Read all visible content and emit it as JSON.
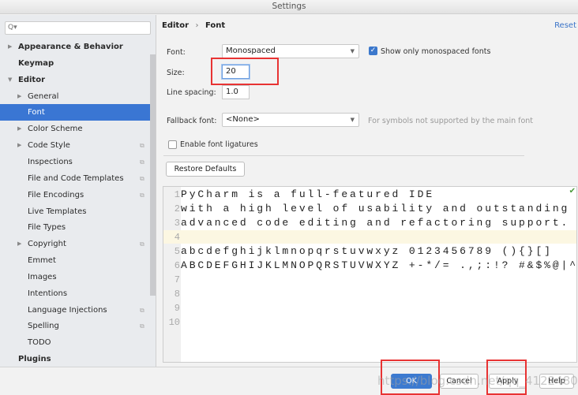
{
  "window": {
    "title": "Settings"
  },
  "search": {
    "placeholder": "Q▾"
  },
  "sidebar": {
    "items": [
      {
        "label": "Appearance & Behavior",
        "bold": true,
        "expandable": true
      },
      {
        "label": "Keymap",
        "bold": true
      },
      {
        "label": "Editor",
        "bold": true,
        "expanded": true
      },
      {
        "label": "General",
        "expandable": true
      },
      {
        "label": "Font",
        "selected": true
      },
      {
        "label": "Color Scheme",
        "expandable": true
      },
      {
        "label": "Code Style",
        "expandable": true,
        "copy_icon": true
      },
      {
        "label": "Inspections",
        "copy_icon": true
      },
      {
        "label": "File and Code Templates",
        "copy_icon": true
      },
      {
        "label": "File Encodings",
        "copy_icon": true
      },
      {
        "label": "Live Templates"
      },
      {
        "label": "File Types"
      },
      {
        "label": "Copyright",
        "expandable": true,
        "copy_icon": true
      },
      {
        "label": "Emmet"
      },
      {
        "label": "Images"
      },
      {
        "label": "Intentions"
      },
      {
        "label": "Language Injections",
        "copy_icon": true
      },
      {
        "label": "Spelling",
        "copy_icon": true
      },
      {
        "label": "TODO"
      },
      {
        "label": "Plugins",
        "bold": true
      }
    ]
  },
  "breadcrumb": {
    "parent": "Editor",
    "sep": "›",
    "current": "Font"
  },
  "reset_label": "Reset",
  "form": {
    "font_label": "Font:",
    "font_value": "Monospaced",
    "mono_only_label": "Show only monospaced fonts",
    "mono_only_checked": true,
    "size_label": "Size:",
    "size_value": "20",
    "line_spacing_label": "Line spacing:",
    "line_spacing_value": "1.0",
    "fallback_label": "Fallback font:",
    "fallback_value": "<None>",
    "fallback_hint": "For symbols not supported by the main font",
    "ligatures_label": "Enable font ligatures",
    "ligatures_checked": false,
    "restore_label": "Restore Defaults"
  },
  "preview": {
    "lines": [
      "PyCharm is a full-featured IDE",
      "with a high level of usability and outstanding",
      "advanced code editing and refactoring support.",
      "",
      "abcdefghijklmnopqrstuvwxyz 0123456789 (){}[]",
      "ABCDEFGHIJKLMNOPQRSTUVWXYZ +-*/= .,;:!? #&$%@|^",
      "",
      "",
      "",
      ""
    ],
    "line_numbers": [
      "1",
      "2",
      "3",
      "4",
      "5",
      "6",
      "7",
      "8",
      "9",
      "10"
    ]
  },
  "buttons": {
    "ok": "OK",
    "cancel": "Cancel",
    "apply": "Apply",
    "help": "Help"
  },
  "watermark": "https://blog.csdn.net/qq_41224804",
  "colors": {
    "accent": "#3a76d3",
    "highlight_box": "#e83333"
  }
}
